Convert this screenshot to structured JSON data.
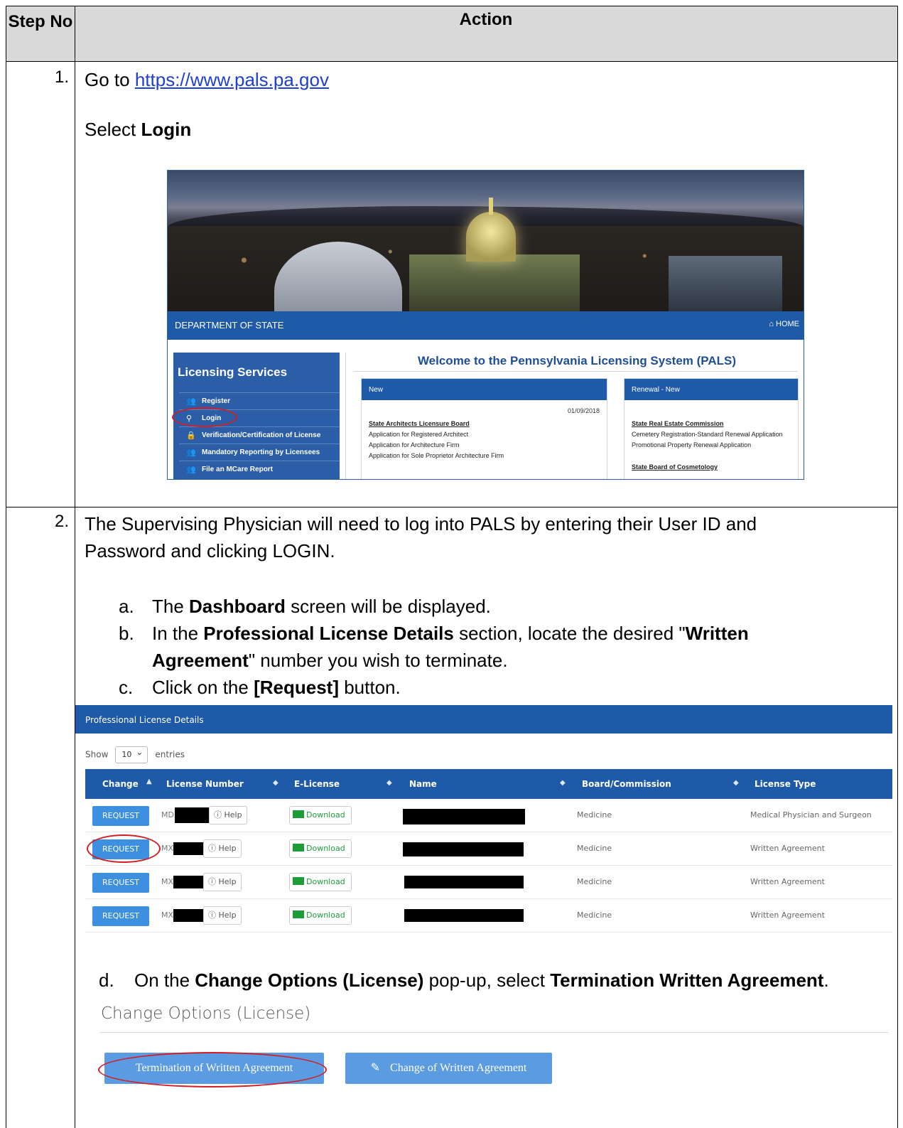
{
  "table": {
    "header": {
      "step": "Step No",
      "action": "Action"
    }
  },
  "step1": {
    "number": "1.",
    "goto_prefix": "Go to ",
    "url": "https://www.pals.pa.gov",
    "select_prefix": "Select ",
    "select_bold": "Login"
  },
  "pals_screen": {
    "dept_title": "DEPARTMENT OF STATE",
    "home": "⌂ HOME",
    "licensing_services": "Licensing Services",
    "menu": [
      {
        "label": "Register",
        "icon": "user-add-icon",
        "glyph": "👥"
      },
      {
        "label": "Login",
        "icon": "user-icon",
        "glyph": "⚲"
      },
      {
        "label": "Verification/Certification of License",
        "icon": "lock-icon",
        "glyph": "🔒"
      },
      {
        "label": "Mandatory Reporting by Licensees",
        "icon": "people-icon",
        "glyph": "👥"
      },
      {
        "label": "File an MCare Report",
        "icon": "people-icon",
        "glyph": "👥"
      }
    ],
    "welcome": "Welcome to the Pennsylvania Licensing System (PALS)",
    "new_box": {
      "header": "New",
      "date": "01/09/2018",
      "board": "State Architects Licensure Board",
      "items": [
        "Application for Registered Architect",
        "Application for Architecture Firm",
        "Application for Sole Proprietor Architecture Firm"
      ]
    },
    "renewal_box": {
      "header": "Renewal - New",
      "board": "State Real Estate Commission",
      "items": [
        "Cemetery Registration-Standard Renewal Application",
        "Promotional Property Renewal Application"
      ],
      "board2": "State Board of Cosmetology"
    }
  },
  "step2": {
    "number": "2.",
    "intro": "The Supervising Physician  will need to log into PALS by entering their User ID and Password and clicking LOGIN.",
    "a": {
      "marker": "a.",
      "pre": "The ",
      "bold": "Dashboard",
      "post": " screen will be displayed."
    },
    "b": {
      "marker": "b.",
      "pre": "In the ",
      "bold1": "Professional License Details",
      "mid": " section, locate the desired \"",
      "bold2": "Written Agreement",
      "post": "\" number you wish to terminate."
    },
    "c": {
      "marker": "c.",
      "pre": "Click on the ",
      "bold": "[Request]",
      "post": " button."
    },
    "d": {
      "marker": "d.",
      "pre": "On the ",
      "bold1": "Change Options (License)",
      "mid": " pop-up, select ",
      "bold2": "Termination Written Agreement",
      "post": "."
    }
  },
  "license_details": {
    "title": "Professional License Details",
    "show": "Show",
    "entries_value": "10",
    "entries": "entries",
    "columns": [
      "Change",
      "License Number",
      "E-License",
      "Name",
      "Board/Commission",
      "License Type"
    ],
    "rows": [
      {
        "request": "REQUEST",
        "prefix": "MD",
        "help": "ⓘ Help",
        "download": "Download",
        "board": "Medicine",
        "type": "Medical Physician and Surgeon"
      },
      {
        "request": "REQUEST",
        "prefix": "MX",
        "help": "ⓘ Help",
        "download": "Download",
        "board": "Medicine",
        "type": "Written Agreement"
      },
      {
        "request": "REQUEST",
        "prefix": "MX",
        "help": "ⓘ Help",
        "download": "Download",
        "board": "Medicine",
        "type": "Written Agreement"
      },
      {
        "request": "REQUEST",
        "prefix": "MX",
        "help": "ⓘ Help",
        "download": "Download",
        "board": "Medicine",
        "type": "Written Agreement"
      }
    ]
  },
  "change_options": {
    "title": "Change Options (License)",
    "termination_button": "Termination of Written Agreement",
    "change_button": "Change of Written Agreement",
    "pencil_icon": "✎"
  },
  "colors": {
    "accent": "#1e5aa8",
    "button": "#3d8fe0",
    "highlight": "#d21f26",
    "link": "#1f3fd0"
  }
}
